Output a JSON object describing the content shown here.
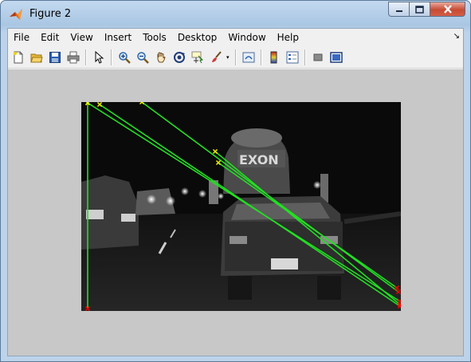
{
  "window": {
    "title": "Figure 2",
    "icons": {
      "app": "matlab-logo-icon",
      "minimize": "minimize-icon",
      "maximize": "maximize-icon",
      "close": "close-icon"
    }
  },
  "menubar": {
    "items": [
      "File",
      "Edit",
      "View",
      "Insert",
      "Tools",
      "Desktop",
      "Window",
      "Help"
    ],
    "dock_icon": "dock-arrow-icon"
  },
  "toolbar": {
    "buttons": [
      "new-figure-icon",
      "open-file-icon",
      "save-figure-icon",
      "print-figure-icon",
      "edit-plot-icon",
      "zoom-in-icon",
      "zoom-out-icon",
      "pan-icon",
      "rotate-3d-icon",
      "data-cursor-icon",
      "brush-icon",
      "link-plot-icon",
      "insert-colorbar-icon",
      "insert-legend-icon",
      "hide-plot-tools-icon",
      "show-plot-tools-icon"
    ]
  },
  "figure": {
    "image_content": "night traffic scene (grayscale)",
    "image_text": "EXON",
    "colors": {
      "match_line": "#22e022",
      "point_start": "#ffff00",
      "point_end": "#ff0000",
      "background": "#c8c8c8"
    }
  }
}
